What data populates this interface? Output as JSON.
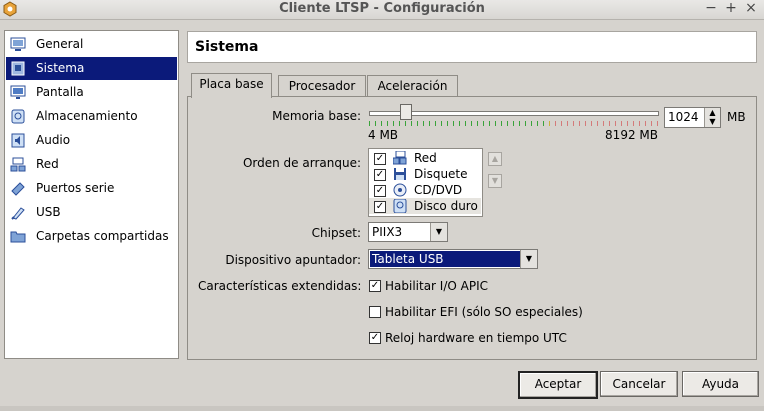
{
  "window": {
    "title": "Cliente LTSP - Configuración",
    "minimize": "−",
    "maximize": "+",
    "close": "×"
  },
  "sidebar": {
    "items": [
      {
        "label": "General",
        "icon": "general-icon"
      },
      {
        "label": "Sistema",
        "icon": "system-chip-icon",
        "selected": true
      },
      {
        "label": "Pantalla",
        "icon": "display-icon"
      },
      {
        "label": "Almacenamiento",
        "icon": "storage-icon"
      },
      {
        "label": "Audio",
        "icon": "audio-icon"
      },
      {
        "label": "Red",
        "icon": "network-icon"
      },
      {
        "label": "Puertos serie",
        "icon": "serial-port-icon"
      },
      {
        "label": "USB",
        "icon": "usb-icon"
      },
      {
        "label": "Carpetas compartidas",
        "icon": "shared-folder-icon"
      }
    ]
  },
  "section_title": "Sistema",
  "tabs": [
    {
      "label": "Placa base",
      "active": true
    },
    {
      "label": "Procesador"
    },
    {
      "label": "Aceleración"
    }
  ],
  "motherboard": {
    "memory": {
      "label": "Memoria base:",
      "value": "1024",
      "unit": "MB",
      "min_label": "4 MB",
      "max_label": "8192 MB",
      "fraction": 0.125
    },
    "boot_order": {
      "label": "Orden de arranque:",
      "items": [
        {
          "label": "Red",
          "checked": true,
          "icon": "network-icon"
        },
        {
          "label": "Disquete",
          "checked": true,
          "icon": "floppy-icon"
        },
        {
          "label": "CD/DVD",
          "checked": true,
          "icon": "cd-dvd-icon"
        },
        {
          "label": "Disco duro",
          "checked": true,
          "icon": "hard-disk-icon",
          "selected": true
        }
      ]
    },
    "chipset": {
      "label": "Chipset:",
      "value": "PIIX3"
    },
    "pointing_device": {
      "label": "Dispositivo apuntador:",
      "value": "Tableta USB"
    },
    "extended": {
      "label": "Características extendidas:",
      "options": [
        {
          "label": "Habilitar I/O APIC",
          "checked": true
        },
        {
          "label": "Habilitar EFI (sólo SO especiales)",
          "checked": false
        },
        {
          "label": "Reloj hardware en tiempo UTC",
          "checked": true
        }
      ]
    }
  },
  "buttons": {
    "accept": "Aceptar",
    "cancel": "Cancelar",
    "help": "Ayuda"
  },
  "colors": {
    "selection": "#0b1a7a",
    "slider_ok": "#3aa33a",
    "slider_warn": "#c9b23a",
    "slider_bad": "#d47a7a"
  }
}
